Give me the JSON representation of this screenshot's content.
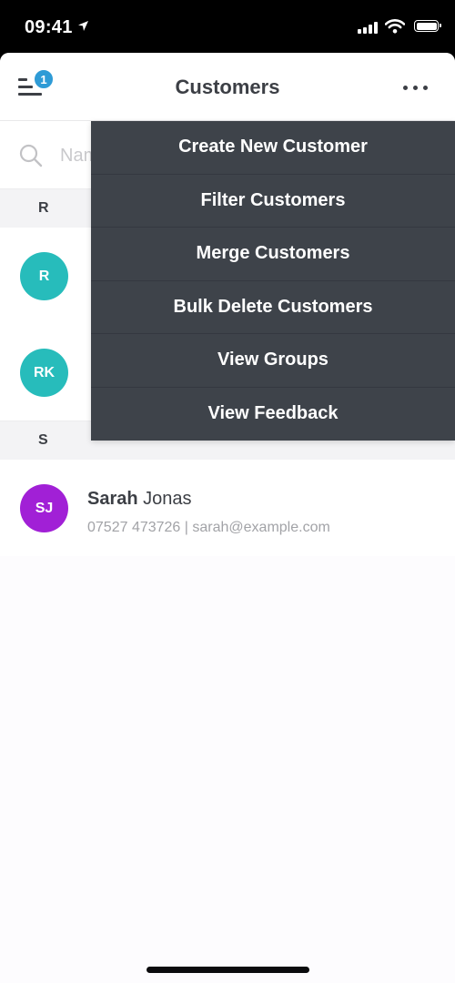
{
  "status_bar": {
    "time": "09:41",
    "icons": [
      "location-arrow-icon",
      "cellular-signal-icon",
      "wifi-icon",
      "battery-icon"
    ]
  },
  "navbar": {
    "title": "Customers",
    "menu_badge_count": "1",
    "left_icon": "hamburger-menu-icon",
    "right_icon": "more-options-icon"
  },
  "search": {
    "placeholder": "Name, email, phone",
    "value": "",
    "icon": "search-icon"
  },
  "customers": {
    "sections": [
      {
        "letter": "R",
        "items": [
          {
            "initials": "R",
            "first": "",
            "last": "",
            "detail": "",
            "avatar_color": "#27bcbb"
          },
          {
            "initials": "RK",
            "first": "",
            "last": "",
            "detail": "",
            "avatar_color": "#27bcbb"
          }
        ]
      },
      {
        "letter": "S",
        "items": [
          {
            "initials": "SJ",
            "first": "Sarah",
            "last": " Jonas",
            "detail": "07527 473726 | sarah@example.com",
            "avatar_color": "#a120d6"
          }
        ]
      }
    ]
  },
  "dropdown_menu": {
    "items": [
      "Create New Customer",
      "Filter Customers",
      "Merge Customers",
      "Bulk Delete Customers",
      "View Groups",
      "View Feedback"
    ]
  },
  "colors": {
    "menu_bg": "#3e434a",
    "badge": "#2e9bd6",
    "teal_avatar": "#27bcbb",
    "purple_avatar": "#a120d6"
  }
}
